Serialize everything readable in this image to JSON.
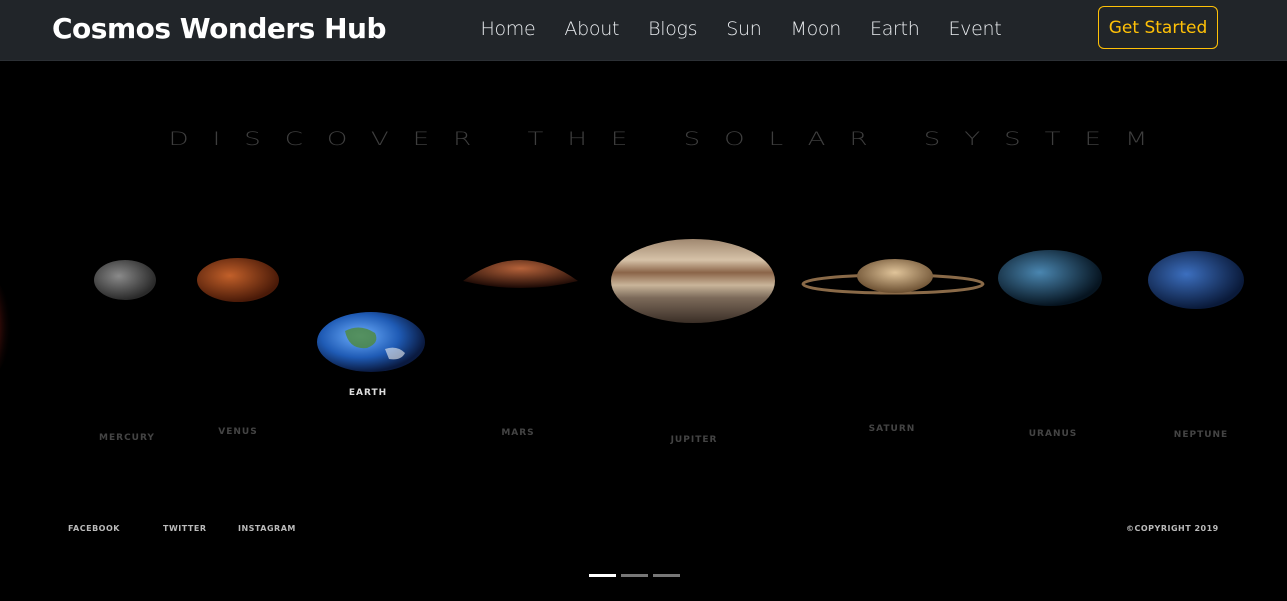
{
  "navbar": {
    "brand": "Cosmos Wonders Hub",
    "links": [
      "Home",
      "About",
      "Blogs",
      "Sun",
      "Moon",
      "Earth",
      "Event"
    ],
    "cta": "Get Started",
    "colors": {
      "background": "#212529",
      "accent": "#ffc107"
    }
  },
  "hero": {
    "title": "DISCOVER THE SOLAR SYSTEM",
    "planets": [
      "MERCURY",
      "VENUS",
      "EARTH",
      "MARS",
      "JUPITER",
      "SATURN",
      "URANUS",
      "NEPTUNE"
    ],
    "active_planet": "EARTH",
    "footer": {
      "social": [
        "FACEBOOK",
        "TWITTER",
        "INSTAGRAM"
      ],
      "copyright": "©COPYRIGHT 2019"
    },
    "carousel": {
      "slide_count": 3,
      "active_index": 0
    }
  }
}
